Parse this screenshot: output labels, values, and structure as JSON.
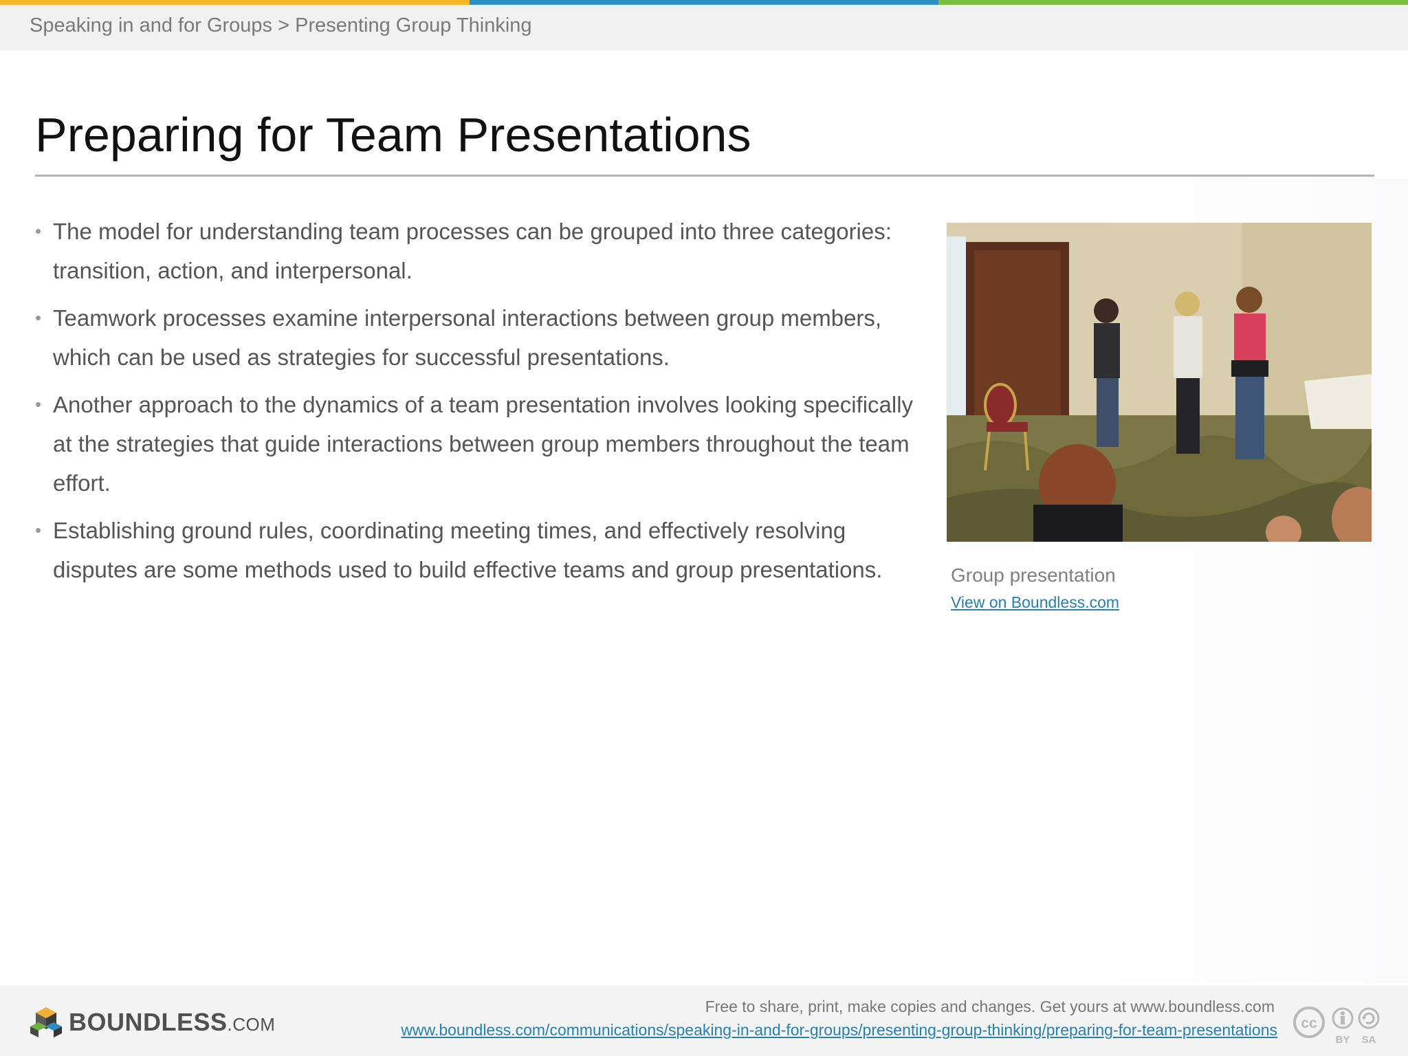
{
  "header": {
    "breadcrumb": "Speaking in and for Groups > Presenting Group Thinking",
    "stripe_colors": [
      "#f7b625",
      "#2b8fc3",
      "#7dbc41"
    ]
  },
  "slide": {
    "title": "Preparing for Team Presentations",
    "bullets": [
      "The model for understanding team processes can be grouped into three categories: transition, action, and interpersonal.",
      "Teamwork processes examine interpersonal interactions between group members, which can be used as strategies for successful presentations.",
      "Another approach to the dynamics of a team presentation involves looking specifically at the strategies that guide interactions between group members throughout the team effort.",
      "Establishing ground rules, coordinating meeting times, and effectively resolving disputes are some methods used to build effective teams and group presentations."
    ]
  },
  "figure": {
    "caption": "Group presentation",
    "link_text": "View on Boundless.com"
  },
  "footer": {
    "logo_text": "BOUNDLESS",
    "logo_suffix": ".COM",
    "note": "Free to share, print, make copies and changes. Get yours at www.boundless.com",
    "url": "www.boundless.com/communications/speaking-in-and-for-groups/presenting-group-thinking/preparing-for-team-presentations",
    "license": {
      "cc": "cc",
      "by": "BY",
      "sa": "SA"
    }
  },
  "colors": {
    "link": "#2480b5",
    "title": "#111111",
    "body_text": "#555555"
  }
}
